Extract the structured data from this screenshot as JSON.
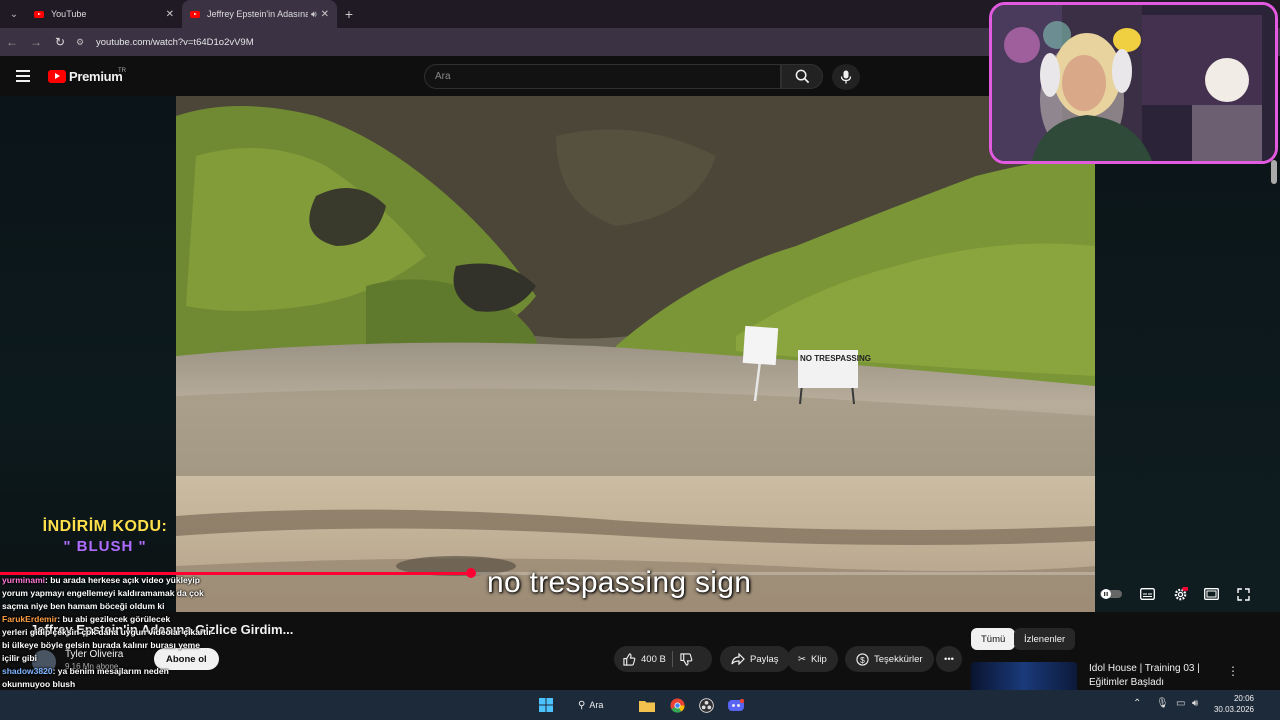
{
  "browser": {
    "tabs": [
      {
        "title": "YouTube",
        "active": false
      },
      {
        "title": "Jeffrey Epstein'in Adasına Gizlice...",
        "active": true
      }
    ],
    "url": "youtube.com/watch?v=t64D1o2vV9M"
  },
  "youtube": {
    "logo_text": "Premium",
    "region": "TR",
    "search_placeholder": "Ara"
  },
  "video": {
    "promo_line1": "İNDİRİM KODU:",
    "promo_line2": "\" BLUSH \"",
    "sign_text": "NO TRESPASSING",
    "subtitle": "no trespassing sign",
    "progress_fraction": 0.43
  },
  "info": {
    "title": "Jeffrey Epstein'in Adasına Gizlice Girdim...",
    "channel_name": "Tyler Oliveira",
    "subscribers": "9,16 Mn abone",
    "subscribe_label": "Abone ol",
    "like_count": "400 B",
    "share_label": "Paylaş",
    "clip_label": "Klip",
    "thanks_label": "Teşekkürler"
  },
  "sidebar": {
    "chips": [
      {
        "label": "Tümü",
        "selected": true
      },
      {
        "label": "İzlenenler",
        "selected": false
      }
    ],
    "rec_title": "Idol House | Training 03 | Eğitimler Başladı"
  },
  "chat": [
    {
      "user": "yurminami",
      "text": ": bu arada herkese açık video yükleyip",
      "color": "#ff7ad8"
    },
    {
      "user": "",
      "text": "yorum yapmayı engellemeyi kaldıramamak da çok",
      "color": ""
    },
    {
      "user": "",
      "text": "saçma niye ben hamam böceği oldum ki",
      "color": ""
    },
    {
      "user": "FarukErdemir",
      "text": ": bu abi gezilecek görülecek",
      "color": "#ff9f45"
    },
    {
      "user": "",
      "text": "yerleri gidip çeksin çok daha uygun videolar çıkartır",
      "color": ""
    },
    {
      "user": "",
      "text": "bi ülkeye böyle gelsin burada kalınır burası yeme",
      "color": ""
    },
    {
      "user": "",
      "text": "içilir gibi",
      "color": ""
    },
    {
      "user": "shadow3820",
      "text": ": ya benim mesajlarım neden",
      "color": "#7fb4ff"
    },
    {
      "user": "",
      "text": "okunmuyoo blush",
      "color": ""
    }
  ],
  "taskbar": {
    "search_label": "Ara",
    "time": "20:06",
    "date": "30.03.2026"
  }
}
